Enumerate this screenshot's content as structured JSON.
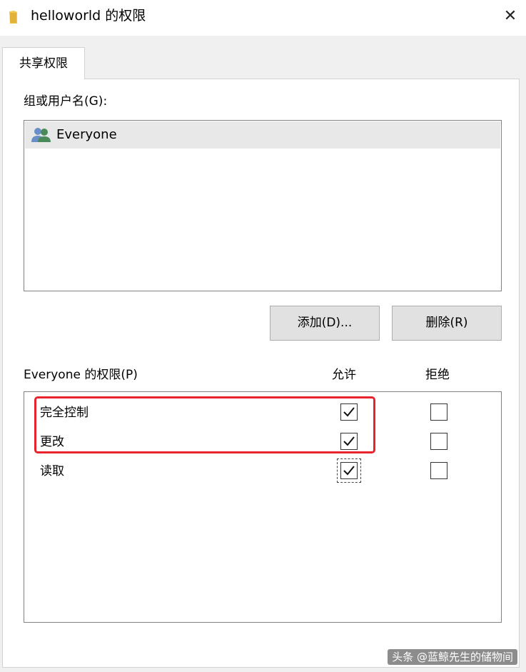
{
  "window": {
    "title": "helloworld 的权限",
    "close_glyph": "✕",
    "icon": "folder-icon",
    "accent_color": "#e8232b"
  },
  "tabs": [
    {
      "label": "共享权限",
      "selected": true
    }
  ],
  "groups": {
    "label": "组或用户名(G):",
    "items": [
      {
        "name": "Everyone",
        "icon": "users-icon",
        "selected": true
      }
    ]
  },
  "buttons": {
    "add_label": "添加(D)...",
    "remove_label": "删除(R)"
  },
  "permissions": {
    "header": "Everyone 的权限(P)",
    "allow_label": "允许",
    "deny_label": "拒绝",
    "rows": [
      {
        "name": "完全控制",
        "allow": true,
        "deny": false
      },
      {
        "name": "更改",
        "allow": true,
        "deny": false
      },
      {
        "name": "读取",
        "allow": true,
        "deny": false
      }
    ]
  },
  "watermark": "头条 @蓝鲸先生的储物间"
}
